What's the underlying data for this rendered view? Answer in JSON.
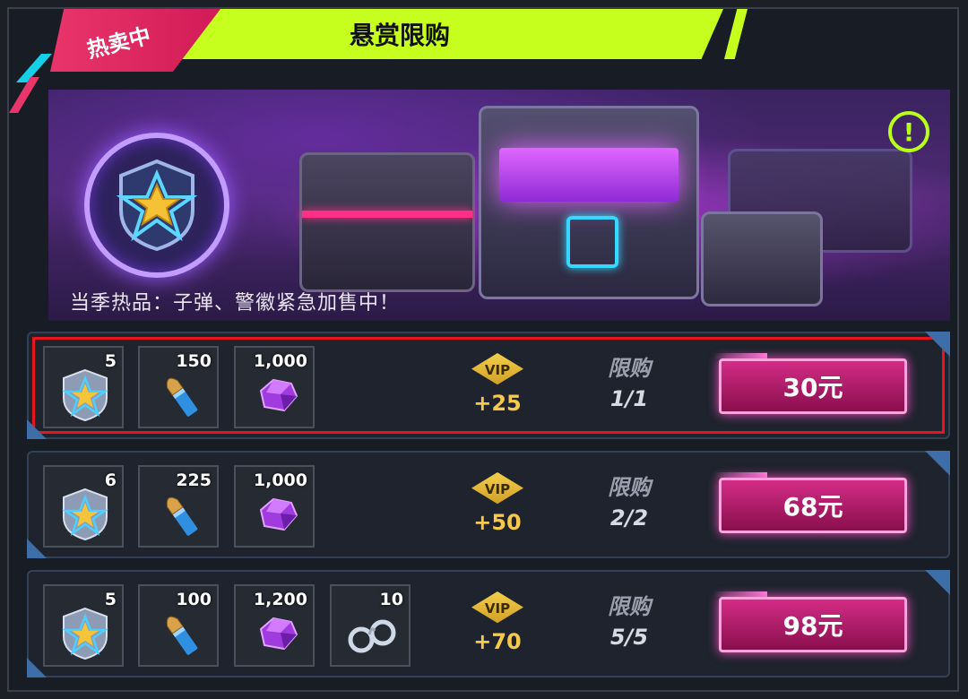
{
  "header": {
    "tag": "热卖中",
    "title": "悬赏限购"
  },
  "banner": {
    "text": "当季热品：子弹、警徽紧急加售中！",
    "alert_icon": "!"
  },
  "colors": {
    "accent_lime": "#c6ff1e",
    "accent_pink": "#e8356b",
    "buy_button": "#c0237a",
    "vip_gold": "#f6c94a"
  },
  "offers": [
    {
      "items": [
        {
          "icon": "police-badge-icon",
          "count": "5"
        },
        {
          "icon": "bullet-icon",
          "count": "150"
        },
        {
          "icon": "purple-gem-icon",
          "count": "1,000"
        }
      ],
      "vip_label": "VIP",
      "vip_bonus": "+25",
      "limit_label": "限购",
      "limit_count": "1/1",
      "price": "30元",
      "selected": true
    },
    {
      "items": [
        {
          "icon": "police-badge-icon",
          "count": "6"
        },
        {
          "icon": "bullet-icon",
          "count": "225"
        },
        {
          "icon": "purple-gem-icon",
          "count": "1,000"
        }
      ],
      "vip_label": "VIP",
      "vip_bonus": "+50",
      "limit_label": "限购",
      "limit_count": "2/2",
      "price": "68元",
      "selected": false
    },
    {
      "items": [
        {
          "icon": "police-badge-icon",
          "count": "5"
        },
        {
          "icon": "bullet-icon",
          "count": "100"
        },
        {
          "icon": "purple-gem-icon",
          "count": "1,200"
        },
        {
          "icon": "handcuffs-icon",
          "count": "10"
        }
      ],
      "vip_label": "VIP",
      "vip_bonus": "+70",
      "limit_label": "限购",
      "limit_count": "5/5",
      "price": "98元",
      "selected": false
    }
  ]
}
